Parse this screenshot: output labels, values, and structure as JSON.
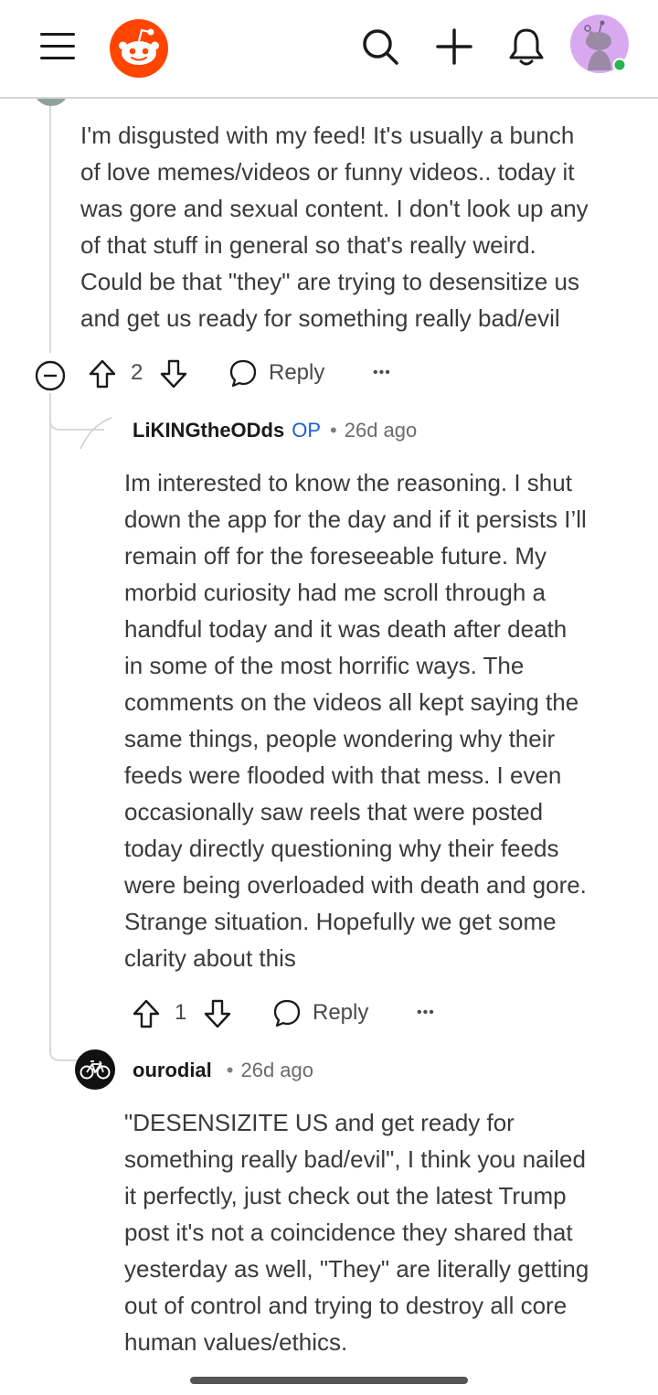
{
  "comments": [
    {
      "body": "I'm disgusted with my feed! It's usually a bunch\nof love memes/videos or funny videos.. today it\nwas gore and sexual content. I don't look up any\nof that stuff in general so that's really weird.\nCould be that \"they\" are trying to desensitize us\nand get us ready for something really bad/evil",
      "votes": "2",
      "reply_label": "Reply",
      "more_label": "•••"
    },
    {
      "username": "LiKINGtheODds",
      "op_badge": "OP",
      "separator": "•",
      "age": "26d ago",
      "body": "Im interested to know the reasoning. I shut\ndown the app for the day and if it persists I’ll\nremain off for the foreseeable future. My\nmorbid curiosity had me scroll through a\nhandful today and it was death after death\nin some of the most horrific ways. The\ncomments on the videos all kept saying the\nsame things, people wondering why their\nfeeds were flooded with that mess. I even\noccasionally saw reels that were posted\ntoday directly questioning why their feeds\nwere being overloaded with death and gore.\nStrange situation. Hopefully we get some\nclarity about this",
      "votes": "1",
      "reply_label": "Reply",
      "more_label": "•••"
    },
    {
      "username": "ourodial",
      "separator": "•",
      "age": "26d ago",
      "body": "\"DESENSIZITE US and get ready for\nsomething really bad/evil\", I think you nailed\nit perfectly, just check out the latest Trump\npost it's not a coincidence they shared that\nyesterday as well, \"They\" are literally getting\nout of control and trying to destroy all core\nhuman values/ethics."
    }
  ],
  "colors": {
    "brand": "#ff4500",
    "op_blue": "#1d5fd1",
    "online_dot": "#2ab44f",
    "avatar_bg": "#d9a9ef"
  },
  "icons": [
    "menu-icon",
    "reddit-logo",
    "search-icon",
    "plus-icon",
    "bell-icon",
    "user-avatar",
    "collapse-icon",
    "upvote-icon",
    "downvote-icon",
    "comment-bubble-icon",
    "bicycle-avatar"
  ]
}
